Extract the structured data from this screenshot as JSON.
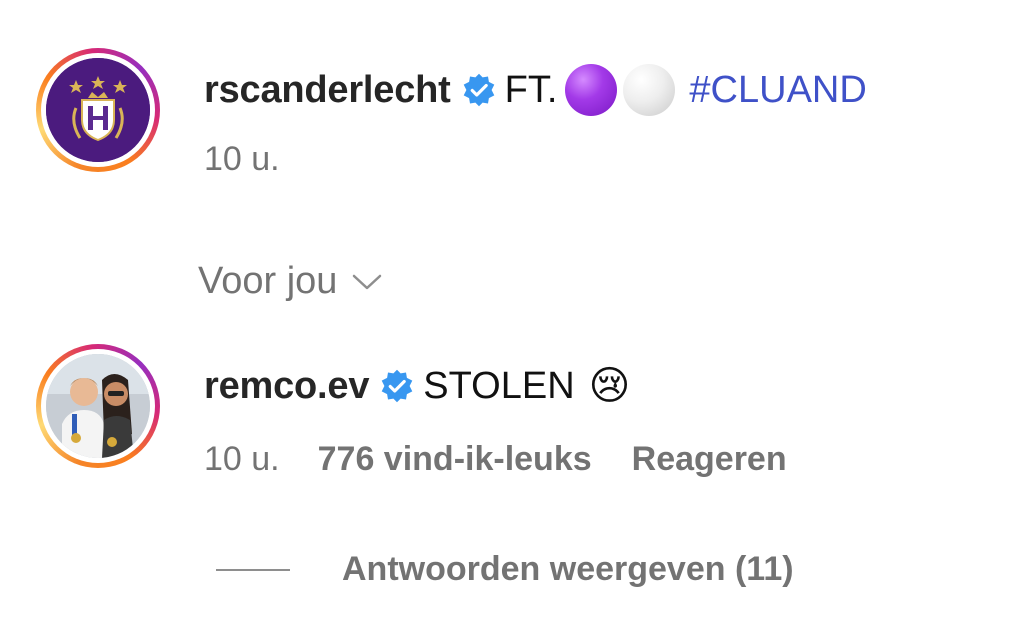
{
  "comments": [
    {
      "username": "rscanderlecht",
      "verified": true,
      "text": "FT.",
      "emojis": [
        "purple-circle",
        "white-circle"
      ],
      "hashtag": "#CLUAND",
      "time": "10 u."
    },
    {
      "username": "remco.ev",
      "verified": true,
      "text": "STOLEN",
      "emoji": "😢",
      "time": "10 u.",
      "likes": "776 vind-ik-leuks",
      "reply_label": "Reageren",
      "view_replies_label": "Antwoorden weergeven (11)"
    }
  ],
  "section_label": "Voor jou",
  "colors": {
    "hashtag": "#3f51c8",
    "verified": "#3897f0",
    "meta": "#737373",
    "rsca_purple": "#4b1b7e"
  },
  "icons": {
    "verified": "verified-badge-icon",
    "dropdown": "chevron-down-icon"
  }
}
